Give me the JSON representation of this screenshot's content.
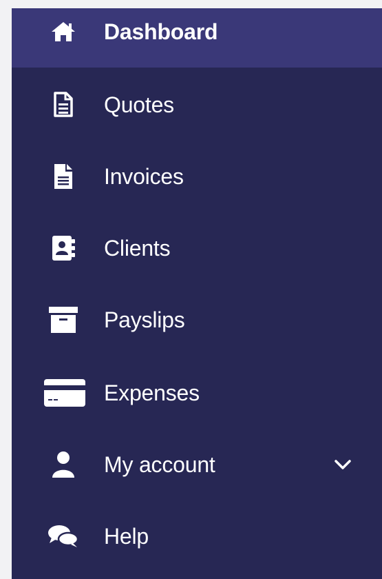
{
  "sidebar": {
    "background": "#272754",
    "active_background": "#3a3878",
    "items": [
      {
        "label": "Dashboard",
        "icon": "home-icon",
        "active": true
      },
      {
        "label": "Quotes",
        "icon": "document-outline-icon"
      },
      {
        "label": "Invoices",
        "icon": "document-filled-icon"
      },
      {
        "label": "Clients",
        "icon": "address-book-icon"
      },
      {
        "label": "Payslips",
        "icon": "archive-box-icon"
      },
      {
        "label": "Expenses",
        "icon": "credit-card-icon"
      },
      {
        "label": "My account",
        "icon": "user-icon",
        "expandable": true
      },
      {
        "label": "Help",
        "icon": "chat-bubbles-icon"
      }
    ]
  }
}
